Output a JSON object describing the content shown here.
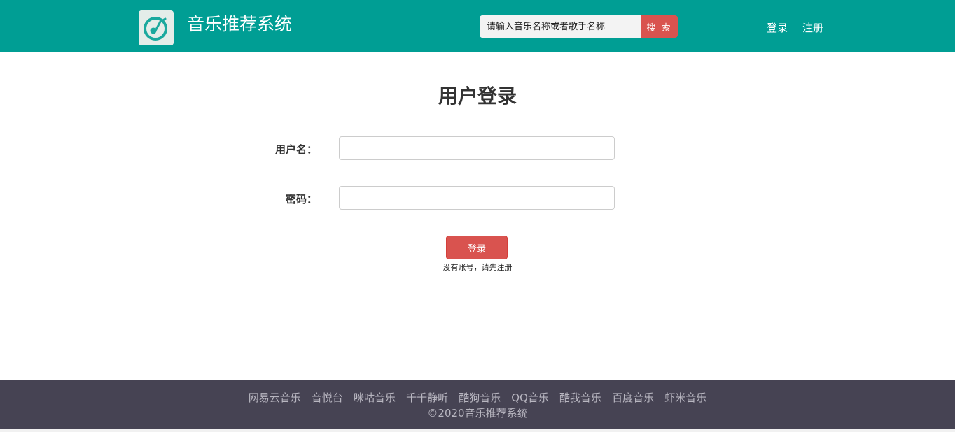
{
  "header": {
    "logo_icon": "music-disc-icon",
    "site_title": "音乐推荐系统",
    "search_placeholder": "请输入音乐名称或者歌手名称",
    "search_button": "搜 索",
    "nav": {
      "login": "登录",
      "register": "注册"
    }
  },
  "main": {
    "title": "用户登录",
    "username_label": "用户名：",
    "password_label": "密码：",
    "username_value": "",
    "password_value": "",
    "login_button": "登录",
    "register_hint": "没有账号，请先注册"
  },
  "footer": {
    "links": [
      "网易云音乐",
      "音悦台",
      "咪咕音乐",
      "千千静听",
      "酷狗音乐",
      "QQ音乐",
      "酷我音乐",
      "百度音乐",
      "虾米音乐"
    ],
    "copyright": "©2020音乐推荐系统"
  },
  "colors": {
    "header_bg": "#009e94",
    "accent_red": "#d9534f",
    "footer_bg": "#464353"
  }
}
